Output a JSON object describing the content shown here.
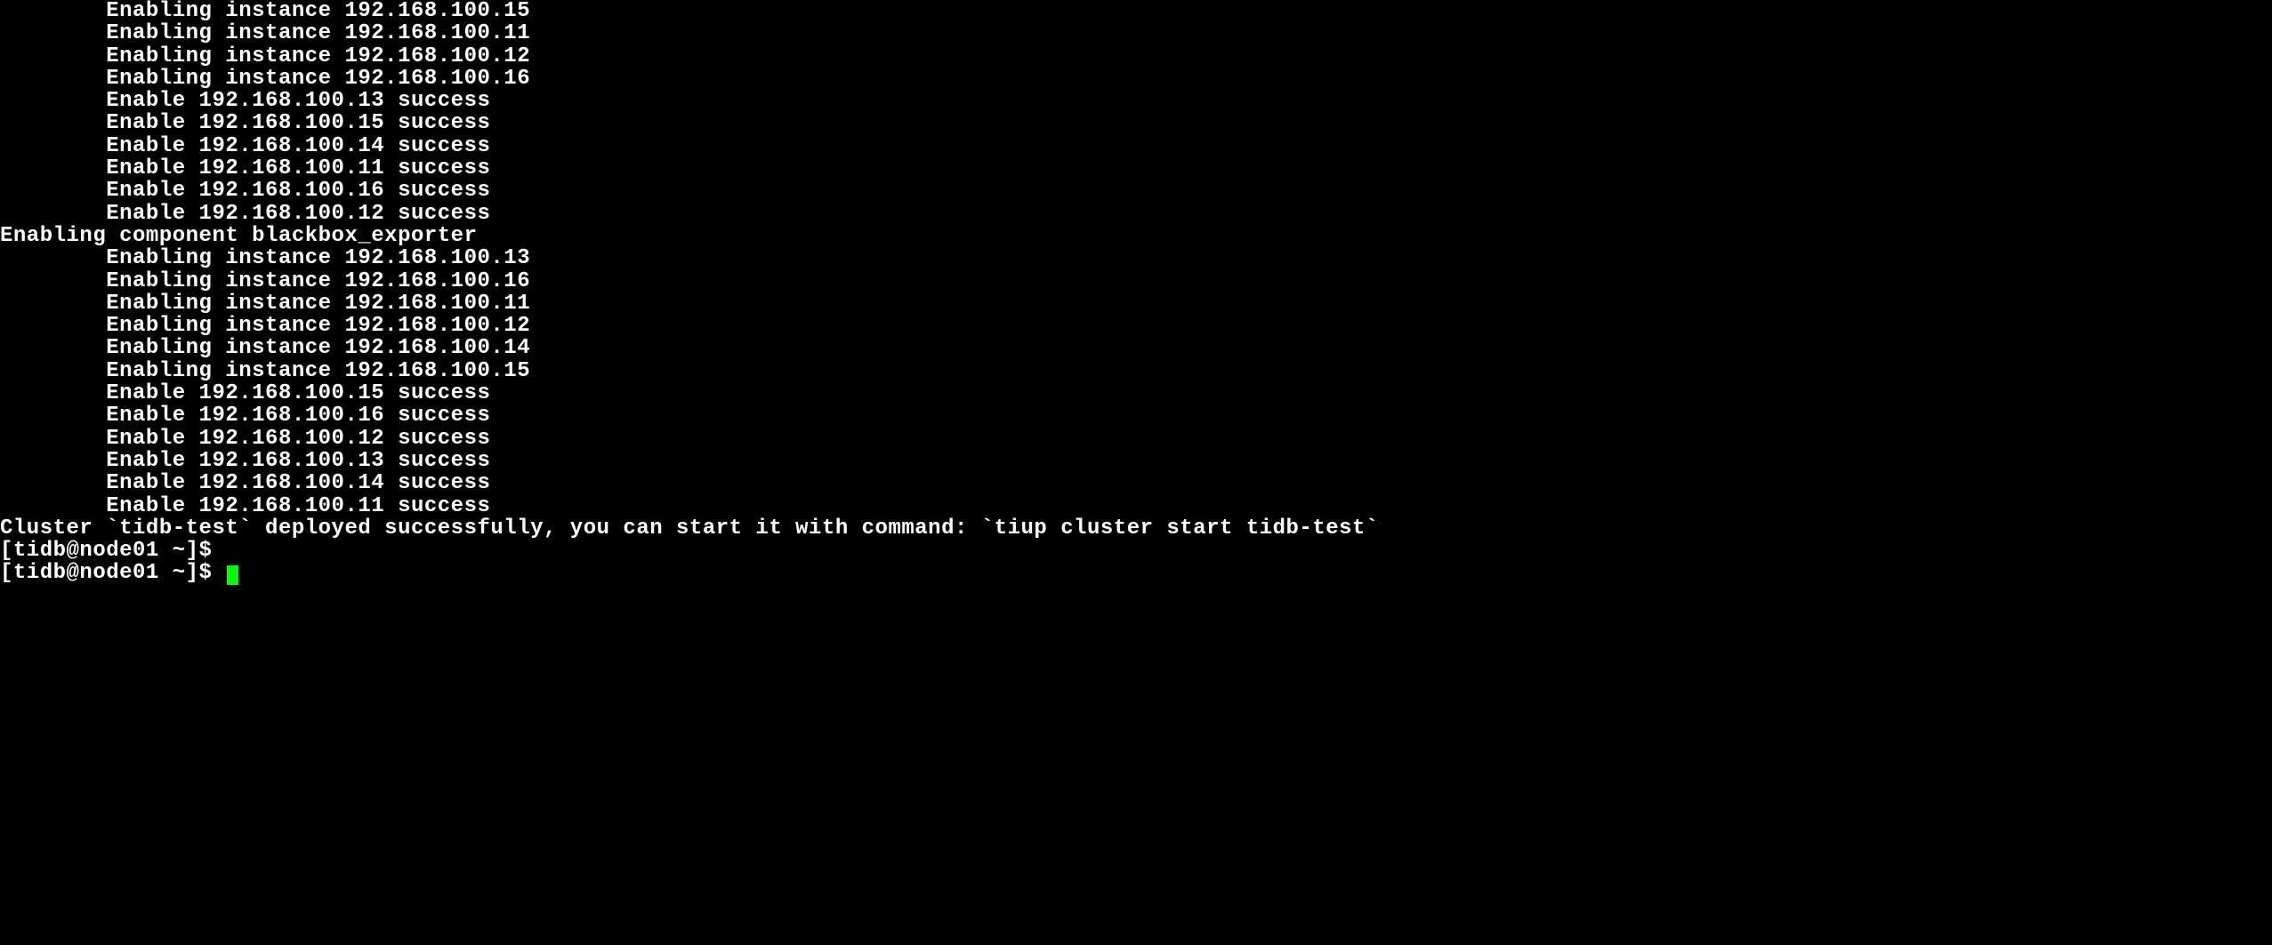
{
  "terminal": {
    "lines": [
      {
        "indent": "        ",
        "text": "Enabling instance 192.168.100.15"
      },
      {
        "indent": "        ",
        "text": "Enabling instance 192.168.100.11"
      },
      {
        "indent": "        ",
        "text": "Enabling instance 192.168.100.12"
      },
      {
        "indent": "        ",
        "text": "Enabling instance 192.168.100.16"
      },
      {
        "indent": "        ",
        "text": "Enable 192.168.100.13 success"
      },
      {
        "indent": "        ",
        "text": "Enable 192.168.100.15 success"
      },
      {
        "indent": "        ",
        "text": "Enable 192.168.100.14 success"
      },
      {
        "indent": "        ",
        "text": "Enable 192.168.100.11 success"
      },
      {
        "indent": "        ",
        "text": "Enable 192.168.100.16 success"
      },
      {
        "indent": "        ",
        "text": "Enable 192.168.100.12 success"
      },
      {
        "indent": "",
        "text": "Enabling component blackbox_exporter"
      },
      {
        "indent": "        ",
        "text": "Enabling instance 192.168.100.13"
      },
      {
        "indent": "        ",
        "text": "Enabling instance 192.168.100.16"
      },
      {
        "indent": "        ",
        "text": "Enabling instance 192.168.100.11"
      },
      {
        "indent": "        ",
        "text": "Enabling instance 192.168.100.12"
      },
      {
        "indent": "        ",
        "text": "Enabling instance 192.168.100.14"
      },
      {
        "indent": "        ",
        "text": "Enabling instance 192.168.100.15"
      },
      {
        "indent": "        ",
        "text": "Enable 192.168.100.15 success"
      },
      {
        "indent": "        ",
        "text": "Enable 192.168.100.16 success"
      },
      {
        "indent": "        ",
        "text": "Enable 192.168.100.12 success"
      },
      {
        "indent": "        ",
        "text": "Enable 192.168.100.13 success"
      },
      {
        "indent": "        ",
        "text": "Enable 192.168.100.14 success"
      },
      {
        "indent": "        ",
        "text": "Enable 192.168.100.11 success"
      },
      {
        "indent": "",
        "text": "Cluster `tidb-test` deployed successfully, you can start it with command: `tiup cluster start tidb-test`"
      }
    ],
    "prompts": [
      "[tidb@node01 ~]$ ",
      "[tidb@node01 ~]$ "
    ]
  }
}
